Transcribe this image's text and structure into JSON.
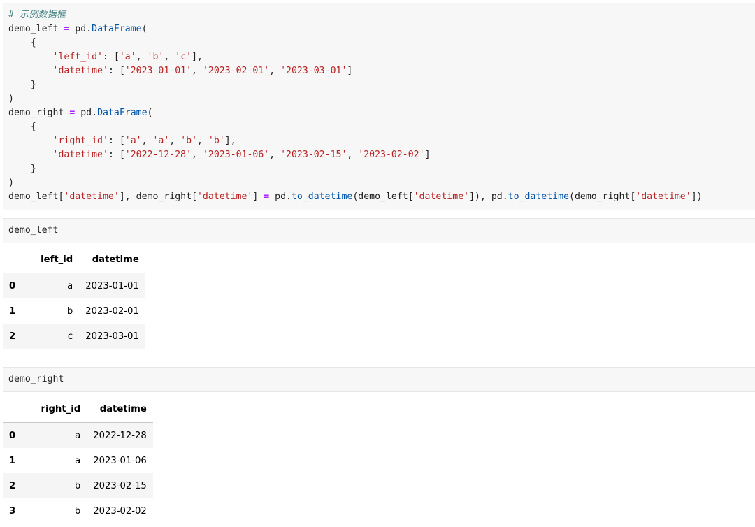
{
  "code_cell": {
    "lines": [
      [
        {
          "t": "cm",
          "v": "# 示例数据框"
        }
      ],
      [
        {
          "t": "pl",
          "v": "demo_left "
        },
        {
          "t": "op",
          "v": "="
        },
        {
          "t": "pl",
          "v": " pd."
        },
        {
          "t": "fn",
          "v": "DataFrame"
        },
        {
          "t": "pl",
          "v": "("
        }
      ],
      [
        {
          "t": "pl",
          "v": "    {"
        }
      ],
      [
        {
          "t": "pl",
          "v": "        "
        },
        {
          "t": "st",
          "v": "'left_id'"
        },
        {
          "t": "pl",
          "v": ": ["
        },
        {
          "t": "st",
          "v": "'a'"
        },
        {
          "t": "pl",
          "v": ", "
        },
        {
          "t": "st",
          "v": "'b'"
        },
        {
          "t": "pl",
          "v": ", "
        },
        {
          "t": "st",
          "v": "'c'"
        },
        {
          "t": "pl",
          "v": "],"
        }
      ],
      [
        {
          "t": "pl",
          "v": "        "
        },
        {
          "t": "st",
          "v": "'datetime'"
        },
        {
          "t": "pl",
          "v": ": ["
        },
        {
          "t": "st",
          "v": "'2023-01-01'"
        },
        {
          "t": "pl",
          "v": ", "
        },
        {
          "t": "st",
          "v": "'2023-02-01'"
        },
        {
          "t": "pl",
          "v": ", "
        },
        {
          "t": "st",
          "v": "'2023-03-01'"
        },
        {
          "t": "pl",
          "v": "]"
        }
      ],
      [
        {
          "t": "pl",
          "v": "    }"
        }
      ],
      [
        {
          "t": "pl",
          "v": ")"
        }
      ],
      [
        {
          "t": "pl",
          "v": "demo_right "
        },
        {
          "t": "op",
          "v": "="
        },
        {
          "t": "pl",
          "v": " pd."
        },
        {
          "t": "fn",
          "v": "DataFrame"
        },
        {
          "t": "pl",
          "v": "("
        }
      ],
      [
        {
          "t": "pl",
          "v": "    {"
        }
      ],
      [
        {
          "t": "pl",
          "v": "        "
        },
        {
          "t": "st",
          "v": "'right_id'"
        },
        {
          "t": "pl",
          "v": ": ["
        },
        {
          "t": "st",
          "v": "'a'"
        },
        {
          "t": "pl",
          "v": ", "
        },
        {
          "t": "st",
          "v": "'a'"
        },
        {
          "t": "pl",
          "v": ", "
        },
        {
          "t": "st",
          "v": "'b'"
        },
        {
          "t": "pl",
          "v": ", "
        },
        {
          "t": "st",
          "v": "'b'"
        },
        {
          "t": "pl",
          "v": "],"
        }
      ],
      [
        {
          "t": "pl",
          "v": "        "
        },
        {
          "t": "st",
          "v": "'datetime'"
        },
        {
          "t": "pl",
          "v": ": ["
        },
        {
          "t": "st",
          "v": "'2022-12-28'"
        },
        {
          "t": "pl",
          "v": ", "
        },
        {
          "t": "st",
          "v": "'2023-01-06'"
        },
        {
          "t": "pl",
          "v": ", "
        },
        {
          "t": "st",
          "v": "'2023-02-15'"
        },
        {
          "t": "pl",
          "v": ", "
        },
        {
          "t": "st",
          "v": "'2023-02-02'"
        },
        {
          "t": "pl",
          "v": "]"
        }
      ],
      [
        {
          "t": "pl",
          "v": "    }"
        }
      ],
      [
        {
          "t": "pl",
          "v": ")"
        }
      ],
      [
        {
          "t": "pl",
          "v": "demo_left["
        },
        {
          "t": "st",
          "v": "'datetime'"
        },
        {
          "t": "pl",
          "v": "], demo_right["
        },
        {
          "t": "st",
          "v": "'datetime'"
        },
        {
          "t": "pl",
          "v": "] "
        },
        {
          "t": "op",
          "v": "="
        },
        {
          "t": "pl",
          "v": " pd."
        },
        {
          "t": "fn",
          "v": "to_datetime"
        },
        {
          "t": "pl",
          "v": "(demo_left["
        },
        {
          "t": "st",
          "v": "'datetime'"
        },
        {
          "t": "pl",
          "v": "]), pd."
        },
        {
          "t": "fn",
          "v": "to_datetime"
        },
        {
          "t": "pl",
          "v": "(demo_right["
        },
        {
          "t": "st",
          "v": "'datetime'"
        },
        {
          "t": "pl",
          "v": "])"
        }
      ]
    ]
  },
  "cell_left": {
    "code": "demo_left"
  },
  "table_left": {
    "columns": [
      "left_id",
      "datetime"
    ],
    "rows": [
      {
        "index": "0",
        "left_id": "a",
        "datetime": "2023-01-01"
      },
      {
        "index": "1",
        "left_id": "b",
        "datetime": "2023-02-01"
      },
      {
        "index": "2",
        "left_id": "c",
        "datetime": "2023-03-01"
      }
    ]
  },
  "cell_right": {
    "code": "demo_right"
  },
  "table_right": {
    "columns": [
      "right_id",
      "datetime"
    ],
    "rows": [
      {
        "index": "0",
        "right_id": "a",
        "datetime": "2022-12-28"
      },
      {
        "index": "1",
        "right_id": "a",
        "datetime": "2023-01-06"
      },
      {
        "index": "2",
        "right_id": "b",
        "datetime": "2023-02-15"
      },
      {
        "index": "3",
        "right_id": "b",
        "datetime": "2023-02-02"
      }
    ]
  },
  "colors": {
    "comment": "#408080",
    "operator": "#aa22ff",
    "function": "#0055aa",
    "string": "#ba2121",
    "cell_background": "#f7f7f7"
  }
}
